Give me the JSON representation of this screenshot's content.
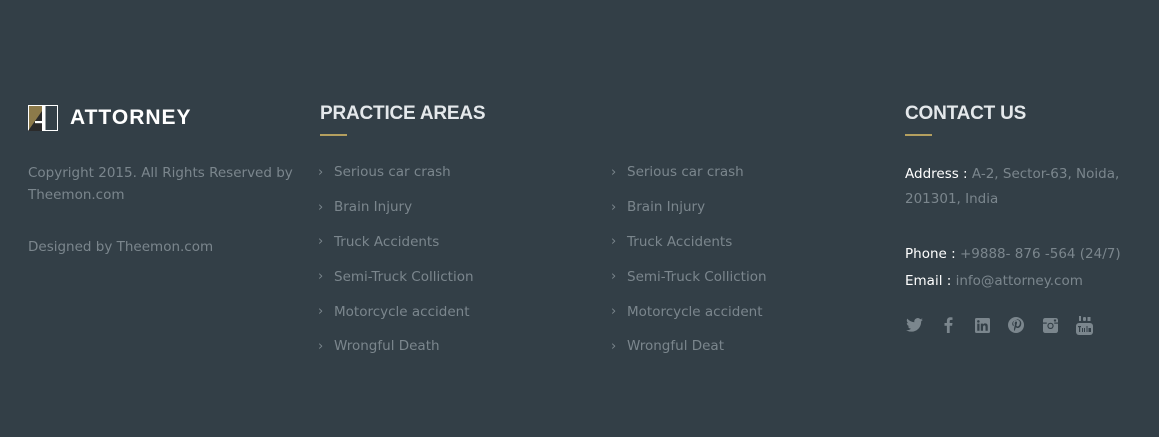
{
  "brand": {
    "name": "ATTORNEY",
    "copyright": "Copyright 2015. All Rights Reserved by Theemon.com",
    "designed_by": "Designed by Theemon.com"
  },
  "practice": {
    "title": "PRACTICE AREAS",
    "chevron": "›",
    "list_left": [
      "Serious car crash",
      "Brain Injury",
      "Truck Accidents",
      "Semi-Truck Colliction",
      "Motorcycle accident",
      "Wrongful Death"
    ],
    "list_right": [
      "Serious car crash",
      "Brain Injury",
      "Truck Accidents",
      "Semi-Truck Colliction",
      "Motorcycle accident",
      "Wrongful Deat"
    ]
  },
  "contact": {
    "title": "CONTACT US",
    "address_label": "Address :",
    "address_value": "A-2, Sector-63, Noida, 201301, India",
    "phone_label": "Phone :",
    "phone_value": "+9888- 876 -564 (24/7)",
    "email_label": "Email :",
    "email_value": "info@attorney.com",
    "social_icons": [
      "twitter-icon",
      "facebook-icon",
      "linkedin-icon",
      "pinterest-icon",
      "instagram-icon",
      "youtube-icon"
    ]
  },
  "colors": {
    "background": "#333f47",
    "accent": "#b49f5f",
    "text_muted": "#7b868d",
    "heading": "#e4e8eb"
  }
}
